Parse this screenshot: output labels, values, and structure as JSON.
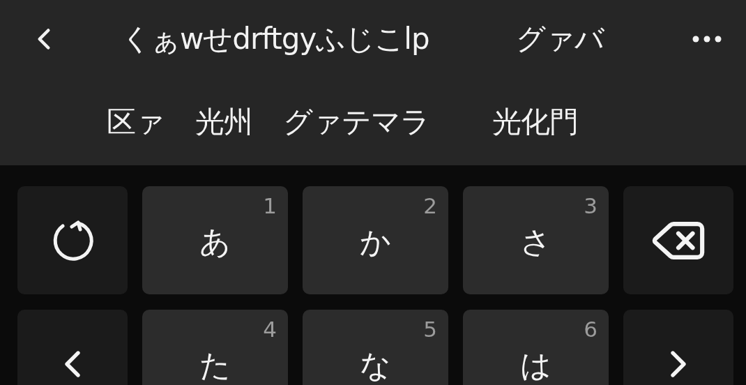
{
  "candidate_bar": {
    "rows": [
      {
        "candidates": [
          "くぁwせdrftgyふじこlp",
          "グァバ"
        ]
      },
      {
        "candidates": [
          "区ァ",
          "光州",
          "グァテマラ",
          "光化門"
        ]
      }
    ]
  },
  "keys": [
    [
      {
        "kind": "undo"
      },
      {
        "kind": "char",
        "label": "あ",
        "number": "1"
      },
      {
        "kind": "char",
        "label": "か",
        "number": "2"
      },
      {
        "kind": "char",
        "label": "さ",
        "number": "3"
      },
      {
        "kind": "backspace"
      }
    ],
    [
      {
        "kind": "left"
      },
      {
        "kind": "char",
        "label": "た",
        "number": "4"
      },
      {
        "kind": "char",
        "label": "な",
        "number": "5"
      },
      {
        "kind": "char",
        "label": "は",
        "number": "6"
      },
      {
        "kind": "right"
      }
    ]
  ]
}
